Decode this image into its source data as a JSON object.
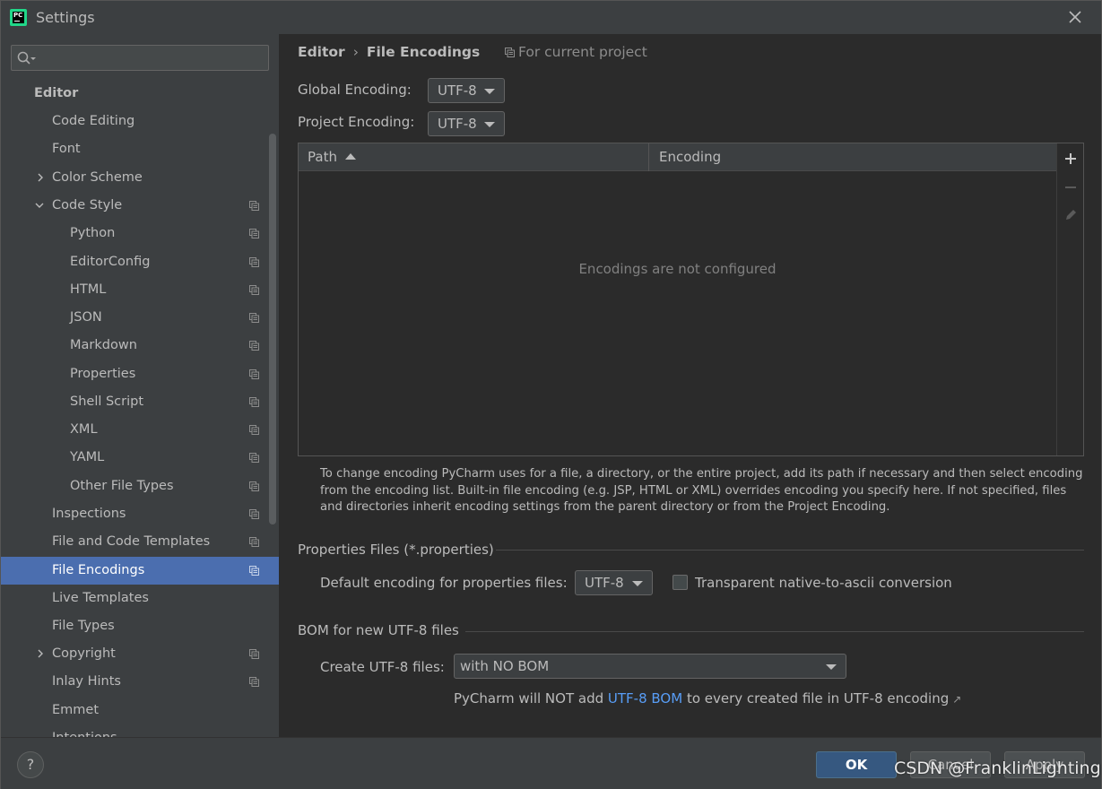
{
  "window": {
    "title": "Settings"
  },
  "search": {
    "placeholder": ""
  },
  "sidebar": {
    "items": [
      {
        "label": "Editor"
      },
      {
        "label": "Code Editing"
      },
      {
        "label": "Font"
      },
      {
        "label": "Color Scheme"
      },
      {
        "label": "Code Style"
      },
      {
        "label": "Python"
      },
      {
        "label": "EditorConfig"
      },
      {
        "label": "HTML"
      },
      {
        "label": "JSON"
      },
      {
        "label": "Markdown"
      },
      {
        "label": "Properties"
      },
      {
        "label": "Shell Script"
      },
      {
        "label": "XML"
      },
      {
        "label": "YAML"
      },
      {
        "label": "Other File Types"
      },
      {
        "label": "Inspections"
      },
      {
        "label": "File and Code Templates"
      },
      {
        "label": "File Encodings"
      },
      {
        "label": "Live Templates"
      },
      {
        "label": "File Types"
      },
      {
        "label": "Copyright"
      },
      {
        "label": "Inlay Hints"
      },
      {
        "label": "Emmet"
      },
      {
        "label": "Intentions"
      }
    ]
  },
  "breadcrumb": {
    "parent": "Editor",
    "separator": "›",
    "current": "File Encodings"
  },
  "scope": {
    "label": "For current project"
  },
  "global_encoding": {
    "label": "Global Encoding:",
    "value": "UTF-8"
  },
  "project_encoding": {
    "label": "Project Encoding:",
    "value": "UTF-8"
  },
  "table": {
    "columns": [
      "Path",
      "Encoding"
    ],
    "empty_text": "Encodings are not configured"
  },
  "help_text": "To change encoding PyCharm uses for a file, a directory, or the entire project, add its path if necessary and then select encoding from the encoding list. Built-in file encoding (e.g. JSP, HTML or XML) overrides encoding you specify here. If not specified, files and directories inherit encoding settings from the parent directory or from the Project Encoding.",
  "properties": {
    "group_title": "Properties Files (*.properties)",
    "default_label": "Default encoding for properties files:",
    "default_value": "UTF-8",
    "transparent_label": "Transparent native-to-ascii conversion",
    "transparent_checked": false
  },
  "bom": {
    "group_title": "BOM for new UTF-8 files",
    "create_label": "Create UTF-8 files:",
    "create_value": "with NO BOM",
    "note_prefix": "PyCharm will NOT add",
    "note_link": "UTF-8 BOM",
    "note_suffix": "to every created file in UTF-8 encoding",
    "note_arrow": "↗"
  },
  "footer": {
    "help": "?",
    "ok": "OK",
    "cancel": "Cancel",
    "apply": "Apply"
  },
  "watermark": "CSDN @FranklinLighting",
  "colors": {
    "background": "#2b2b2b",
    "panel": "#3c3f41",
    "selection": "#4b6eaf",
    "link": "#589df6",
    "default_button": "#365880"
  }
}
